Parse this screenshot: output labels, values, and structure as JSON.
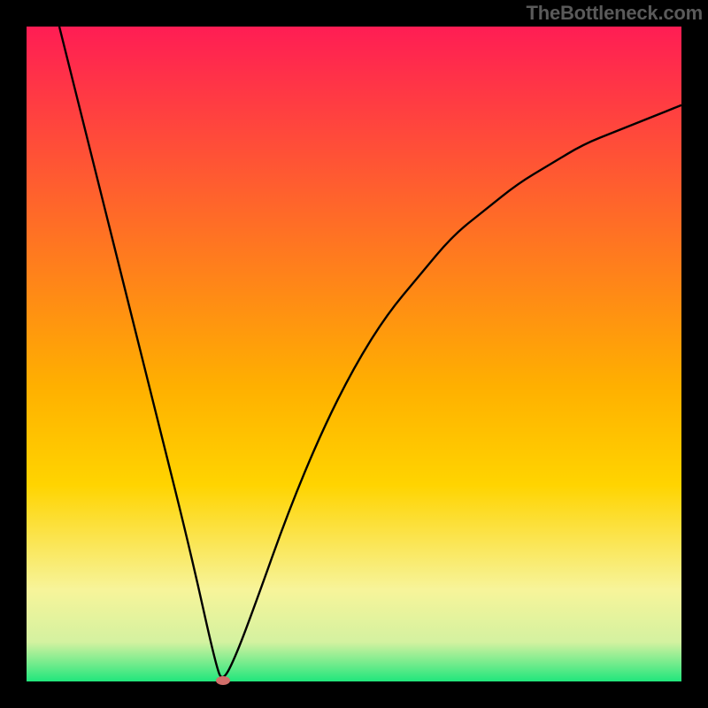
{
  "attribution": "TheBottleneck.com",
  "colors": {
    "top": "#ff1d54",
    "mid": "#ffd400",
    "tanBand": "#f7f49a",
    "bottom": "#21e67c",
    "line": "#000000",
    "border": "#000000",
    "marker": "#d26e6a"
  },
  "chart_data": {
    "type": "line",
    "title": "",
    "xlabel": "",
    "ylabel": "",
    "xlim": [
      0,
      100
    ],
    "ylim": [
      0,
      100
    ],
    "series": [
      {
        "name": "curve",
        "x": [
          5,
          10,
          15,
          20,
          25,
          29,
          30,
          32,
          35,
          40,
          45,
          50,
          55,
          60,
          65,
          70,
          75,
          80,
          85,
          90,
          95,
          100
        ],
        "y": [
          100,
          80,
          60,
          40,
          20,
          2,
          0,
          4,
          12,
          26,
          38,
          48,
          56,
          62,
          68,
          72,
          76,
          79,
          82,
          84,
          86,
          88
        ]
      }
    ],
    "marker": {
      "x": 30,
      "y": 0
    }
  }
}
